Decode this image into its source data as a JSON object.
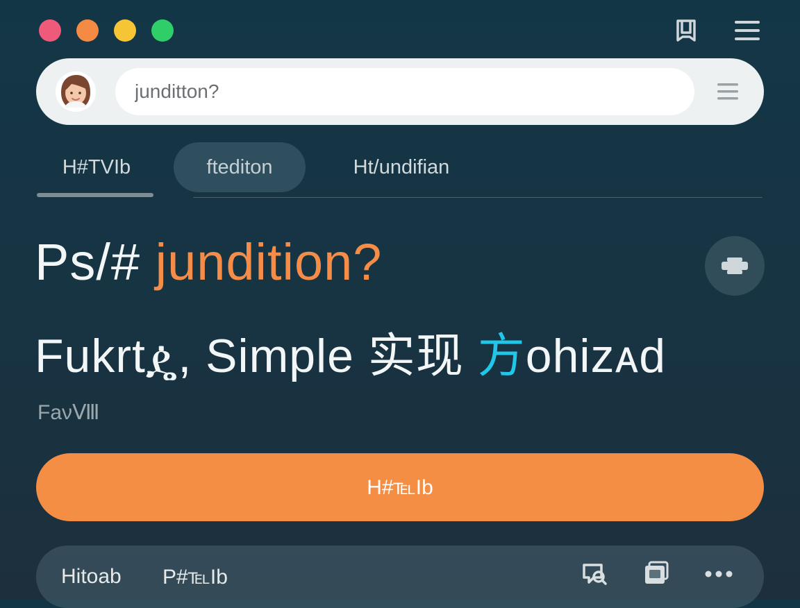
{
  "window": {
    "controls": [
      {
        "name": "red",
        "color": "#ef5a7a"
      },
      {
        "name": "orange",
        "color": "#f48a43"
      },
      {
        "name": "yellow",
        "color": "#f6c536"
      },
      {
        "name": "green",
        "color": "#2fce68"
      }
    ],
    "top_actions": [
      {
        "icon": "bookmark-icon"
      },
      {
        "icon": "menu-icon"
      }
    ]
  },
  "search": {
    "placeholder": "junditton?",
    "avatar": {
      "icon": "avatar-icon"
    },
    "menu": {
      "icon": "menu-icon"
    }
  },
  "tabs": [
    {
      "label": "H#TVIb"
    },
    {
      "label": "ftediton"
    },
    {
      "label": "Ht/undifian"
    }
  ],
  "hero": {
    "title_prefix": "Ps/#",
    "title_highlight": "jundition?",
    "subtitle_prefix": "Fukrtዼ, Simple 实现",
    "subtitle_highlight": "方",
    "subtitle_suffix": "ohiᴢᴀd",
    "caption": "FaνⅧ",
    "action_icon": "toggle-icon"
  },
  "primary_button": {
    "label": "H#℡Ib"
  },
  "bottom_bar": {
    "items": [
      {
        "label": "Hitoab"
      },
      {
        "label": "P#℡Ib"
      }
    ],
    "icons": [
      {
        "icon": "search-chat-icon"
      },
      {
        "icon": "window-stack-icon"
      },
      {
        "icon": "more-icon"
      }
    ]
  },
  "colors": {
    "background": "#163544",
    "accent": "#f58e45",
    "highlight": "#20c7e8",
    "surface": "#eef1f2"
  }
}
